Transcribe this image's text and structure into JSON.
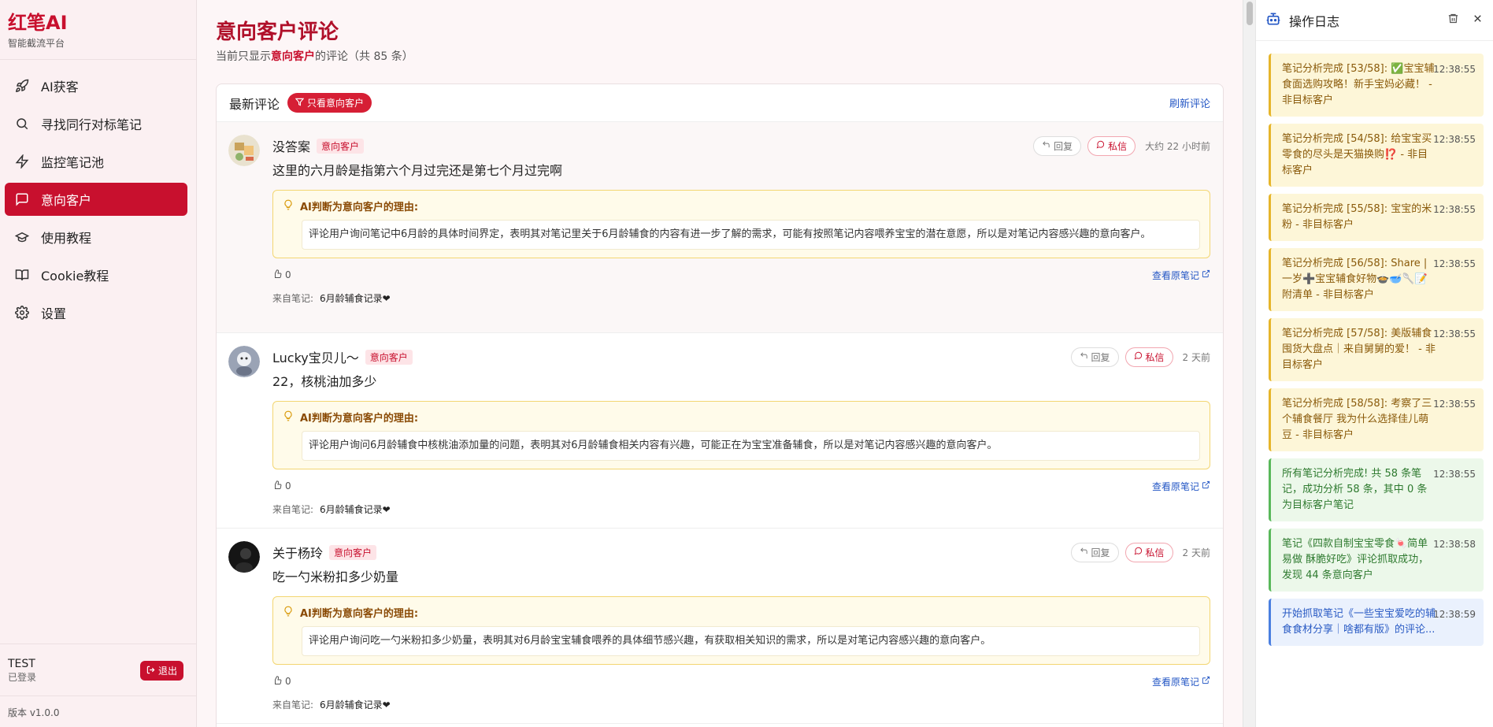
{
  "brand": {
    "title": "红笔AI",
    "subtitle": "智能截流平台"
  },
  "nav": [
    {
      "label": "AI获客",
      "icon": "rocket-icon"
    },
    {
      "label": "寻找同行对标笔记",
      "icon": "search-icon"
    },
    {
      "label": "监控笔记池",
      "icon": "bolt-icon"
    },
    {
      "label": "意向客户",
      "icon": "chat-icon",
      "active": true
    },
    {
      "label": "使用教程",
      "icon": "graduation-cap-icon"
    },
    {
      "label": "Cookie教程",
      "icon": "book-icon"
    },
    {
      "label": "设置",
      "icon": "gear-icon"
    }
  ],
  "user": {
    "name": "TEST",
    "status": "已登录",
    "logout_label": "退出"
  },
  "version": "版本 v1.0.0",
  "page": {
    "title": "意向客户评论",
    "sub_prefix": "当前只显示",
    "sub_highlight": "意向客户",
    "sub_suffix": "的评论（共 85 条）"
  },
  "card": {
    "title": "最新评论",
    "filter_label": "只看意向客户",
    "refresh_label": "刷新评论"
  },
  "labels": {
    "tag": "意向客户",
    "reply": "回复",
    "dm": "私信",
    "reason_title": "AI判断为意向客户的理由:",
    "view_note": "查看原笔记",
    "from": "来自笔记:"
  },
  "comments": [
    {
      "name": "没答案",
      "time": "大约 22 小时前",
      "text": "这里的六月龄是指第六个月过完还是第七个月过完啊",
      "reason": "评论用户询问笔记中6月龄的具体时间界定，表明其对笔记里关于6月龄辅食的内容有进一步了解的需求，可能有按照笔记内容喂养宝宝的潜在意愿，所以是对笔记内容感兴趣的意向客户。",
      "likes": "0",
      "note": "6月龄辅食记录❤"
    },
    {
      "name": "Lucky宝贝儿～",
      "time": "2 天前",
      "text": "22，核桃油加多少",
      "reason": "评论用户询问6月龄辅食中核桃油添加量的问题，表明其对6月龄辅食相关内容有兴趣，可能正在为宝宝准备辅食，所以是对笔记内容感兴趣的意向客户。",
      "likes": "0",
      "note": "6月龄辅食记录❤"
    },
    {
      "name": "关于杨玲",
      "time": "2 天前",
      "text": "吃一勺米粉扣多少奶量",
      "reason": "评论用户询问吃一勺米粉扣多少奶量，表明其对6月龄宝宝辅食喂养的具体细节感兴趣，有获取相关知识的需求，所以是对笔记内容感兴趣的意向客户。",
      "likes": "0",
      "note": "6月龄辅食记录❤"
    }
  ],
  "log": {
    "title": "操作日志",
    "items": [
      {
        "type": "warn",
        "time": "12:38:55",
        "text": "笔记分析完成 [53/58]: ✅宝宝辅食面选购攻略！新手宝妈必藏！ - 非目标客户"
      },
      {
        "type": "warn",
        "time": "12:38:55",
        "text": "笔记分析完成 [54/58]: 给宝宝买零食的尽头是天猫换购⁉️ - 非目标客户"
      },
      {
        "type": "warn",
        "time": "12:38:55",
        "text": "笔记分析完成 [55/58]: 宝宝的米粉 - 非目标客户"
      },
      {
        "type": "warn",
        "time": "12:38:55",
        "text": "笔记分析完成 [56/58]: Share | 一岁➕宝宝辅食好物🍲🥣🥄📝附清单 - 非目标客户"
      },
      {
        "type": "warn",
        "time": "12:38:55",
        "text": "笔记分析完成 [57/58]: 美版辅食囤货大盘点｜来自舅舅的爱！ - 非目标客户"
      },
      {
        "type": "warn",
        "time": "12:38:55",
        "text": "笔记分析完成 [58/58]: 考察了三个辅食餐厅 我为什么选择佳儿萌豆 - 非目标客户"
      },
      {
        "type": "ok",
        "time": "12:38:55",
        "text": "所有笔记分析完成! 共 58 条笔记，成功分析 58 条，其中 0 条为目标客户笔记"
      },
      {
        "type": "ok",
        "time": "12:38:58",
        "text": "笔记《四款自制宝宝零食🍬简单易做 酥脆好吃》评论抓取成功，发现 44 条意向客户"
      },
      {
        "type": "info",
        "time": "12:38:59",
        "text": "开始抓取笔记《一些宝宝爱吃的辅食食材分享｜啥都有版》的评论..."
      }
    ]
  }
}
